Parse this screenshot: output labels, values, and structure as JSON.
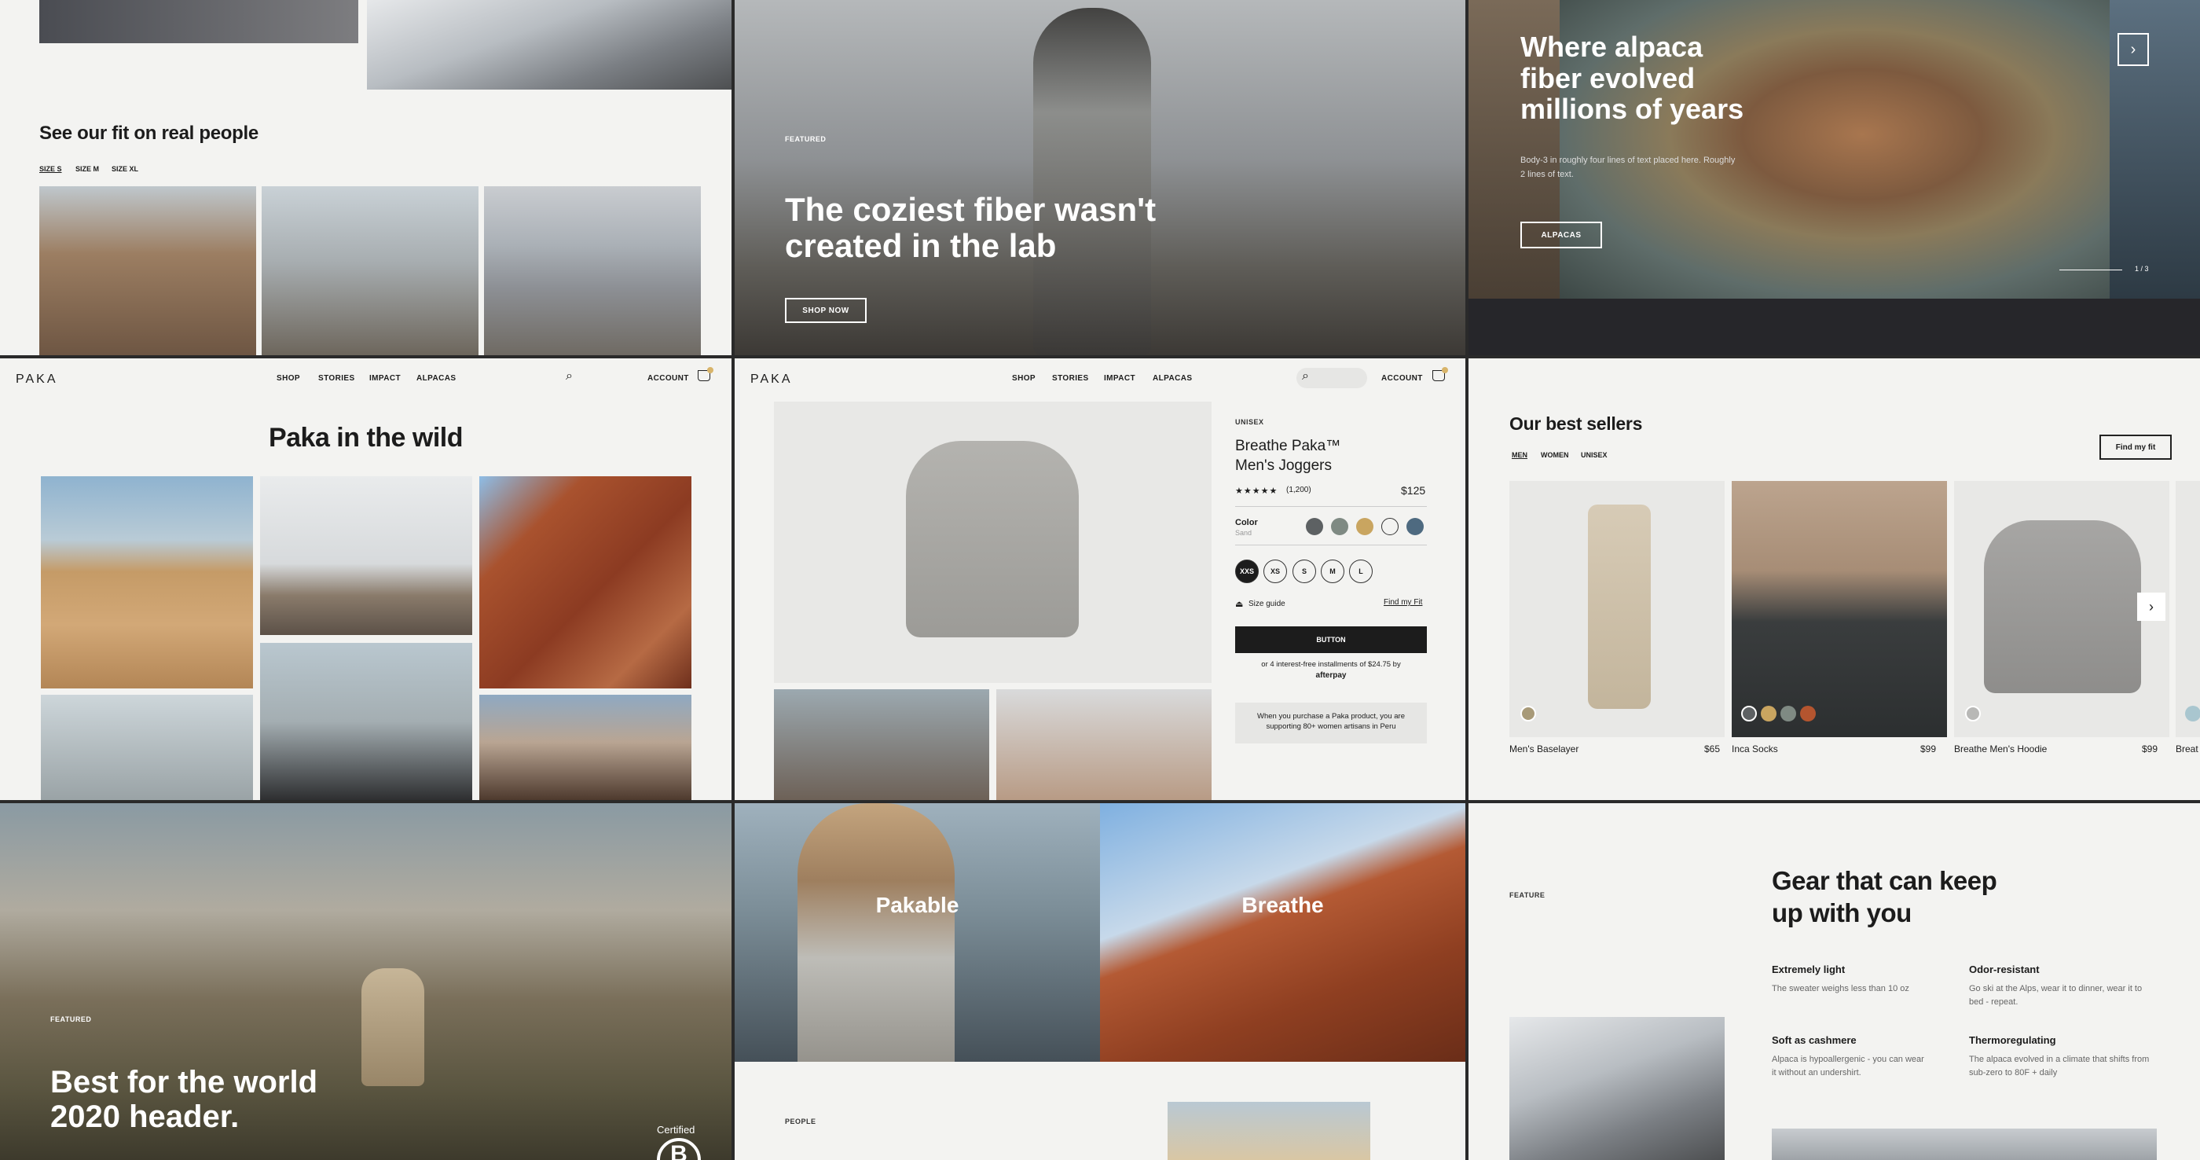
{
  "fit": {
    "title": "See our fit on real people",
    "sizes": [
      "SIZE S",
      "SIZE M",
      "SIZE XL"
    ]
  },
  "hero_fiber": {
    "kicker": "FEATURED",
    "title": "The coziest fiber wasn't created in the lab",
    "button": "SHOP NOW"
  },
  "hero_alpaca": {
    "title": "Where alpaca fiber evolved millions of years",
    "body": "Body-3 in roughly four lines of text placed here. Roughly 2 lines of text.",
    "button": "ALPACAS",
    "pager": "1 / 3",
    "next_icon": "chevron-right-icon"
  },
  "nav": {
    "logo": "PAKA",
    "links": [
      "SHOP",
      "STORIES",
      "IMPACT",
      "ALPACAS"
    ],
    "account": "ACCOUNT",
    "cart_count": ""
  },
  "wild": {
    "title": "Paka in the wild"
  },
  "product": {
    "tag": "UNISEX",
    "name": "Breathe Paka™ Men's Joggers",
    "rating_count": "(1,200)",
    "price": "$125",
    "color_label": "Color",
    "color_value": "Sand",
    "colors": [
      "#5d6163",
      "#7f8a83",
      "#c9a560",
      "#f3f3f1",
      "#4e6a80"
    ],
    "sizes": [
      "XXS",
      "XS",
      "S",
      "M",
      "L"
    ],
    "size_guide": "Size guide",
    "find_fit": "Find my Fit",
    "button": "BUTTON",
    "installments": "or 4 interest-free installments of $24.75 by",
    "afterpay": "afterpay",
    "note": "When you purchase a Paka product, you are supporting 80+ women artisans in Peru"
  },
  "bestsellers": {
    "title": "Our best sellers",
    "tabs": [
      "MEN",
      "WOMEN",
      "UNISEX"
    ],
    "find_fit": "Find my fit",
    "items": [
      {
        "name": "Men's Baselayer",
        "price": "$65"
      },
      {
        "name": "Inca Socks",
        "price": "$99"
      },
      {
        "name": "Breathe Men's Hoodie",
        "price": "$99"
      },
      {
        "name": "Breat",
        "price": ""
      }
    ]
  },
  "bcorp": {
    "kicker": "FEATURED",
    "title": "Best for the world 2020 header.",
    "certified": "Certified"
  },
  "categories": {
    "left": "Pakable",
    "right": "Breathe",
    "people": "PEOPLE"
  },
  "gear": {
    "kicker": "FEATURE",
    "title": "Gear that can keep up with you",
    "features": [
      {
        "h": "Extremely light",
        "p": "The sweater weighs less than 10 oz"
      },
      {
        "h": "Odor-resistant",
        "p": "Go ski at the Alps, wear it to dinner, wear it to bed - repeat."
      },
      {
        "h": "Soft as cashmere",
        "p": "Alpaca is hypoallergenic - you can wear it without an undershirt."
      },
      {
        "h": "Thermoregulating",
        "p": "The alpaca evolved in a climate that shifts from sub-zero to 80F + daily"
      }
    ]
  }
}
